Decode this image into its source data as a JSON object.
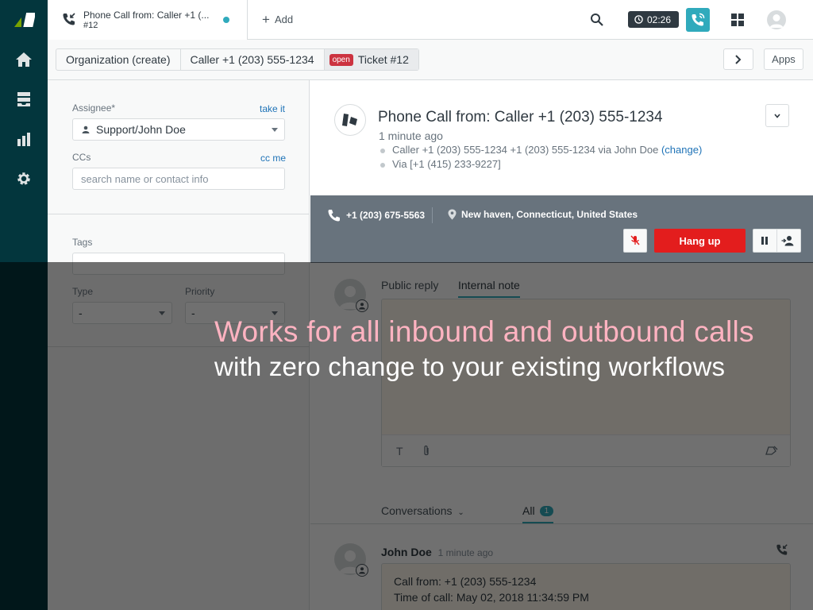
{
  "nav": {
    "icons": [
      "zendesk-logo",
      "home-icon",
      "views-icon",
      "reporting-icon",
      "admin-gear-icon"
    ]
  },
  "topbar": {
    "tab_title": "Phone Call from: Caller +1 (...",
    "tab_subtitle": "#12",
    "add_label": "Add",
    "timer": "02:26"
  },
  "breadcrumbs": {
    "organization": "Organization (create)",
    "caller": "Caller +1 (203) 555-1234",
    "status_badge": "open",
    "ticket": "Ticket #12",
    "apps_label": "Apps"
  },
  "properties": {
    "assignee_label": "Assignee*",
    "take_it": "take it",
    "assignee_value": "Support/John Doe",
    "ccs_label": "CCs",
    "cc_me": "cc me",
    "ccs_placeholder": "search name or contact info",
    "tags_label": "Tags",
    "type_label": "Type",
    "type_value": "-",
    "priority_label": "Priority",
    "priority_value": "-"
  },
  "ticket": {
    "title": "Phone Call from: Caller +1 (203) 555-1234",
    "time": "1 minute ago",
    "line1": "Caller +1 (203) 555-1234 +1 (203) 555-1234 via John Doe",
    "line1_link": "(change)",
    "line2": "Via [+1 (415) 233-9227]"
  },
  "call": {
    "number": "+1 (203) 675-5563",
    "location": "New haven, Connecticut, United States",
    "hangup": "Hang up"
  },
  "composer": {
    "tab_public": "Public reply",
    "tab_internal": "Internal note",
    "tool_text": "T"
  },
  "conversation": {
    "filter_label": "Conversations",
    "all_label": "All",
    "all_count": "1",
    "author": "John Doe",
    "author_time": "1 minute ago",
    "line1": "Call from: +1 (203) 555-1234",
    "line2": "Time of call: May 02, 2018 11:34:59 PM"
  },
  "promo": {
    "line1": "Works for all inbound and outbound calls",
    "line2": "with zero change to your existing workflows"
  },
  "colors": {
    "nav_bg": "#03363d",
    "accent": "#30aabc",
    "hangup": "#e31d1d",
    "open_badge": "#cc3340",
    "promo_pink": "#ffb3c1"
  }
}
